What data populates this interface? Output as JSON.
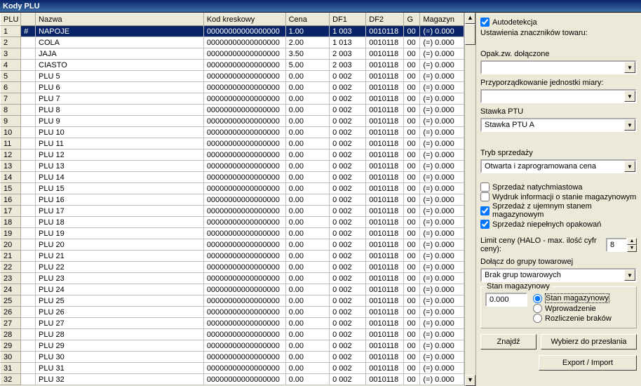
{
  "title": "Kody PLU",
  "columns": {
    "plu": "PLU",
    "nazwa": "Nazwa",
    "kod": "Kod kreskowy",
    "cena": "Cena",
    "df1": "DF1",
    "df2": "DF2",
    "g": "G",
    "magazyn": "Magazyn"
  },
  "rows": [
    {
      "plu": "1",
      "mark": "#",
      "nazwa": "NAPOJE",
      "kod": "00000000000000000",
      "cena": "1.00",
      "df1": "1 003",
      "df2": "0010118",
      "g": "00",
      "mag": "(=) 0.000"
    },
    {
      "plu": "2",
      "mark": "",
      "nazwa": "COLA",
      "kod": "00000000000000000",
      "cena": "2.00",
      "df1": "1 013",
      "df2": "0010118",
      "g": "00",
      "mag": "(=) 0.000"
    },
    {
      "plu": "3",
      "mark": "",
      "nazwa": "JAJA",
      "kod": "00000000000000000",
      "cena": "3.50",
      "df1": "2 003",
      "df2": "0010118",
      "g": "00",
      "mag": "(=) 0.000"
    },
    {
      "plu": "4",
      "mark": "",
      "nazwa": "CIASTO",
      "kod": "00000000000000000",
      "cena": "5.00",
      "df1": "2 003",
      "df2": "0010118",
      "g": "00",
      "mag": "(=) 0.000"
    },
    {
      "plu": "5",
      "mark": "",
      "nazwa": "PLU 5",
      "kod": "00000000000000000",
      "cena": "0.00",
      "df1": "0 002",
      "df2": "0010118",
      "g": "00",
      "mag": "(=) 0.000"
    },
    {
      "plu": "6",
      "mark": "",
      "nazwa": "PLU 6",
      "kod": "00000000000000000",
      "cena": "0.00",
      "df1": "0 002",
      "df2": "0010118",
      "g": "00",
      "mag": "(=) 0.000"
    },
    {
      "plu": "7",
      "mark": "",
      "nazwa": "PLU 7",
      "kod": "00000000000000000",
      "cena": "0.00",
      "df1": "0 002",
      "df2": "0010118",
      "g": "00",
      "mag": "(=) 0.000"
    },
    {
      "plu": "8",
      "mark": "",
      "nazwa": "PLU 8",
      "kod": "00000000000000000",
      "cena": "0.00",
      "df1": "0 002",
      "df2": "0010118",
      "g": "00",
      "mag": "(=) 0.000"
    },
    {
      "plu": "9",
      "mark": "",
      "nazwa": "PLU 9",
      "kod": "00000000000000000",
      "cena": "0.00",
      "df1": "0 002",
      "df2": "0010118",
      "g": "00",
      "mag": "(=) 0.000"
    },
    {
      "plu": "10",
      "mark": "",
      "nazwa": "PLU 10",
      "kod": "00000000000000000",
      "cena": "0.00",
      "df1": "0 002",
      "df2": "0010118",
      "g": "00",
      "mag": "(=) 0.000"
    },
    {
      "plu": "11",
      "mark": "",
      "nazwa": "PLU 11",
      "kod": "00000000000000000",
      "cena": "0.00",
      "df1": "0 002",
      "df2": "0010118",
      "g": "00",
      "mag": "(=) 0.000"
    },
    {
      "plu": "12",
      "mark": "",
      "nazwa": "PLU 12",
      "kod": "00000000000000000",
      "cena": "0.00",
      "df1": "0 002",
      "df2": "0010118",
      "g": "00",
      "mag": "(=) 0.000"
    },
    {
      "plu": "13",
      "mark": "",
      "nazwa": "PLU 13",
      "kod": "00000000000000000",
      "cena": "0.00",
      "df1": "0 002",
      "df2": "0010118",
      "g": "00",
      "mag": "(=) 0.000"
    },
    {
      "plu": "14",
      "mark": "",
      "nazwa": "PLU 14",
      "kod": "00000000000000000",
      "cena": "0.00",
      "df1": "0 002",
      "df2": "0010118",
      "g": "00",
      "mag": "(=) 0.000"
    },
    {
      "plu": "15",
      "mark": "",
      "nazwa": "PLU 15",
      "kod": "00000000000000000",
      "cena": "0.00",
      "df1": "0 002",
      "df2": "0010118",
      "g": "00",
      "mag": "(=) 0.000"
    },
    {
      "plu": "16",
      "mark": "",
      "nazwa": "PLU 16",
      "kod": "00000000000000000",
      "cena": "0.00",
      "df1": "0 002",
      "df2": "0010118",
      "g": "00",
      "mag": "(=) 0.000"
    },
    {
      "plu": "17",
      "mark": "",
      "nazwa": "PLU 17",
      "kod": "00000000000000000",
      "cena": "0.00",
      "df1": "0 002",
      "df2": "0010118",
      "g": "00",
      "mag": "(=) 0.000"
    },
    {
      "plu": "18",
      "mark": "",
      "nazwa": "PLU 18",
      "kod": "00000000000000000",
      "cena": "0.00",
      "df1": "0 002",
      "df2": "0010118",
      "g": "00",
      "mag": "(=) 0.000"
    },
    {
      "plu": "19",
      "mark": "",
      "nazwa": "PLU 19",
      "kod": "00000000000000000",
      "cena": "0.00",
      "df1": "0 002",
      "df2": "0010118",
      "g": "00",
      "mag": "(=) 0.000"
    },
    {
      "plu": "20",
      "mark": "",
      "nazwa": "PLU 20",
      "kod": "00000000000000000",
      "cena": "0.00",
      "df1": "0 002",
      "df2": "0010118",
      "g": "00",
      "mag": "(=) 0.000"
    },
    {
      "plu": "21",
      "mark": "",
      "nazwa": "PLU 21",
      "kod": "00000000000000000",
      "cena": "0.00",
      "df1": "0 002",
      "df2": "0010118",
      "g": "00",
      "mag": "(=) 0.000"
    },
    {
      "plu": "22",
      "mark": "",
      "nazwa": "PLU 22",
      "kod": "00000000000000000",
      "cena": "0.00",
      "df1": "0 002",
      "df2": "0010118",
      "g": "00",
      "mag": "(=) 0.000"
    },
    {
      "plu": "23",
      "mark": "",
      "nazwa": "PLU 23",
      "kod": "00000000000000000",
      "cena": "0.00",
      "df1": "0 002",
      "df2": "0010118",
      "g": "00",
      "mag": "(=) 0.000"
    },
    {
      "plu": "24",
      "mark": "",
      "nazwa": "PLU 24",
      "kod": "00000000000000000",
      "cena": "0.00",
      "df1": "0 002",
      "df2": "0010118",
      "g": "00",
      "mag": "(=) 0.000"
    },
    {
      "plu": "25",
      "mark": "",
      "nazwa": "PLU 25",
      "kod": "00000000000000000",
      "cena": "0.00",
      "df1": "0 002",
      "df2": "0010118",
      "g": "00",
      "mag": "(=) 0.000"
    },
    {
      "plu": "26",
      "mark": "",
      "nazwa": "PLU 26",
      "kod": "00000000000000000",
      "cena": "0.00",
      "df1": "0 002",
      "df2": "0010118",
      "g": "00",
      "mag": "(=) 0.000"
    },
    {
      "plu": "27",
      "mark": "",
      "nazwa": "PLU 27",
      "kod": "00000000000000000",
      "cena": "0.00",
      "df1": "0 002",
      "df2": "0010118",
      "g": "00",
      "mag": "(=) 0.000"
    },
    {
      "plu": "28",
      "mark": "",
      "nazwa": "PLU 28",
      "kod": "00000000000000000",
      "cena": "0.00",
      "df1": "0 002",
      "df2": "0010118",
      "g": "00",
      "mag": "(=) 0.000"
    },
    {
      "plu": "29",
      "mark": "",
      "nazwa": "PLU 29",
      "kod": "00000000000000000",
      "cena": "0.00",
      "df1": "0 002",
      "df2": "0010118",
      "g": "00",
      "mag": "(=) 0.000"
    },
    {
      "plu": "30",
      "mark": "",
      "nazwa": "PLU 30",
      "kod": "00000000000000000",
      "cena": "0.00",
      "df1": "0 002",
      "df2": "0010118",
      "g": "00",
      "mag": "(=) 0.000"
    },
    {
      "plu": "31",
      "mark": "",
      "nazwa": "PLU 31",
      "kod": "00000000000000000",
      "cena": "0.00",
      "df1": "0 002",
      "df2": "0010118",
      "g": "00",
      "mag": "(=) 0.000"
    },
    {
      "plu": "32",
      "mark": "",
      "nazwa": "PLU 32",
      "kod": "00000000000000000",
      "cena": "0.00",
      "df1": "0 002",
      "df2": "0010118",
      "g": "00",
      "mag": "(=) 0.000"
    }
  ],
  "right": {
    "autodetect": "Autodetekcja",
    "settings_heading": "Ustawienia znaczników towaru:",
    "opak_label": "Opak.zw. dołączone",
    "opak_value": "",
    "unit_label": "Przyporządkowanie jednostki miary:",
    "unit_value": "",
    "ptu_label": "Stawka PTU",
    "ptu_value": "Stawka PTU A",
    "mode_label": "Tryb sprzedaży",
    "mode_value": "Otwarta i zaprogramowana cena",
    "chk_immediate": "Sprzedaż natychmiastowa",
    "chk_stock_info": "Wydruk informacji o stanie magazynowym",
    "chk_negative": "Sprzedaż z ujemnym stanem magazynowym",
    "chk_partial": "Sprzedaż niepełnych opakowań",
    "halo_label": "Limit ceny (HALO - max. ilość cyfr ceny):",
    "halo_value": "8",
    "group_label": "Dołącz do grupy towarowej",
    "group_value": "Brak grup towarowych",
    "stock_group": "Stan magazynowy",
    "stock_value": "0.000",
    "radio_stock": "Stan magazynowy",
    "radio_input": "Wprowadzenie",
    "radio_short": "Rozliczenie braków",
    "btn_find": "Znajdź",
    "btn_select": "Wybierz do przesłania",
    "btn_export": "Export / Import"
  }
}
